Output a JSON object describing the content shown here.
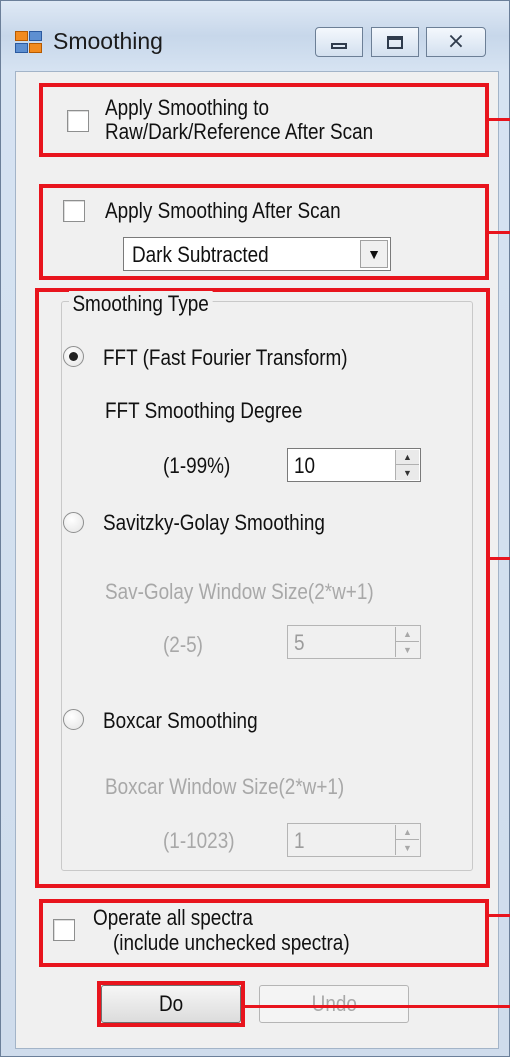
{
  "window": {
    "title": "Smoothing"
  },
  "title_buttons": {
    "minimize_icon": "minimize-icon",
    "maximize_icon": "maximize-icon",
    "close_icon": "close-icon",
    "close_glyph": "⨯"
  },
  "apply_raw": {
    "line1": "Apply Smoothing to",
    "line2": "Raw/Dark/Reference After Scan",
    "checked": false
  },
  "apply_after": {
    "label": "Apply Smoothing After Scan",
    "checked": false,
    "dropdown_value": "Dark Subtracted",
    "dropdown_arrow": "▼"
  },
  "smoothing_type": {
    "group_title": "Smoothing Type",
    "fft": {
      "label": "FFT (Fast Fourier Transform)",
      "selected": true,
      "degree_label": "FFT Smoothing Degree",
      "range_label": "(1-99%)",
      "value": "10"
    },
    "savgol": {
      "label": "Savitzky-Golay Smoothing",
      "selected": false,
      "window_label": "Sav-Golay Window Size(2*w+1)",
      "range_label": "(2-5)",
      "value": "5"
    },
    "boxcar": {
      "label": "Boxcar Smoothing",
      "selected": false,
      "window_label": "Boxcar Window Size(2*w+1)",
      "range_label": "(1-1023)",
      "value": "1"
    }
  },
  "operate_all": {
    "line1": "Operate all spectra",
    "line2": "(include unchecked spectra)",
    "checked": false
  },
  "buttons": {
    "do_label": "Do",
    "undo_label": "Undo"
  },
  "colors": {
    "highlight": "#e8141d",
    "disabled_text": "#a8a8a8"
  }
}
